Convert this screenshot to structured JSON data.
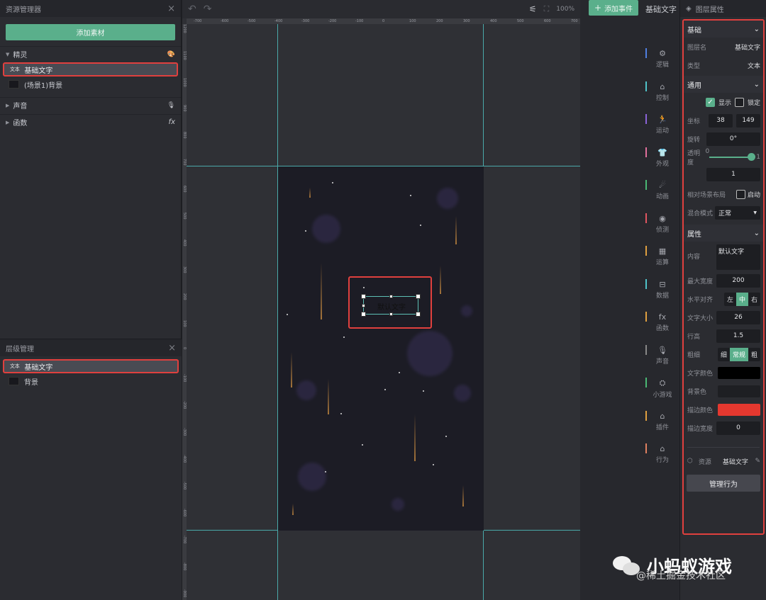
{
  "left_panel": {
    "title": "资源管理器",
    "close": "×",
    "add_button": "添加素材",
    "groups": [
      {
        "label": "精灵",
        "icon": "palette-icon",
        "glyph": "🎨"
      },
      {
        "label": "声音",
        "icon": "microphone-icon",
        "glyph": "🎙"
      },
      {
        "label": "函数",
        "icon": "function-icon",
        "glyph": "fx"
      }
    ],
    "sprites": [
      {
        "icon_text": "文本",
        "label": "基础文字",
        "selected": true
      },
      {
        "label": "(场景1)背景",
        "selected": false
      }
    ]
  },
  "layers_panel": {
    "title": "层级管理",
    "close": "×",
    "items": [
      {
        "icon_text": "文本",
        "label": "基础文字",
        "selected": true
      },
      {
        "label": "背景",
        "selected": false
      }
    ]
  },
  "toolbar": {
    "undo": "↶",
    "redo": "↷",
    "zoom": "100%"
  },
  "ruler": {
    "h_ticks": [
      "-700",
      "-600",
      "-500",
      "-400",
      "-300",
      "-200",
      "-100",
      "0",
      "100",
      "200",
      "300",
      "400",
      "500",
      "600",
      "700"
    ],
    "v_ticks": [
      "1200",
      "1100",
      "1000",
      "900",
      "800",
      "700",
      "600",
      "500",
      "400",
      "300",
      "200",
      "100",
      "0",
      "-100",
      "-200",
      "-300",
      "-400",
      "-500",
      "-600",
      "-700",
      "-800",
      "-900"
    ]
  },
  "canvas": {
    "default_text": "默认文字"
  },
  "event_strip": {
    "add_event": "添加事件",
    "current": "基础文字",
    "nav": [
      {
        "label": "逻辑",
        "icon": "logic-icon",
        "glyph": "⚙",
        "color": "#4f7fe0"
      },
      {
        "label": "控制",
        "icon": "control-icon",
        "glyph": "⌂",
        "color": "#4fc3c9"
      },
      {
        "label": "运动",
        "icon": "motion-icon",
        "glyph": "🏃",
        "color": "#8a63d8"
      },
      {
        "label": "外观",
        "icon": "appearance-icon",
        "glyph": "👕",
        "color": "#e06f9c"
      },
      {
        "label": "动画",
        "icon": "animation-icon",
        "glyph": "☄",
        "color": "#4ab874"
      },
      {
        "label": "侦测",
        "icon": "detect-icon",
        "glyph": "◉",
        "color": "#e05560"
      },
      {
        "label": "运算",
        "icon": "calc-icon",
        "glyph": "▦",
        "color": "#e0a040"
      },
      {
        "label": "数据",
        "icon": "data-icon",
        "glyph": "⊟",
        "color": "#4fc3c9"
      },
      {
        "label": "函数",
        "icon": "function-icon",
        "glyph": "fx",
        "color": "#e0a040"
      },
      {
        "label": "声音",
        "icon": "sound-icon",
        "glyph": "🎙",
        "color": "#888888"
      },
      {
        "label": "小游戏",
        "icon": "minigame-icon",
        "glyph": "⛭",
        "color": "#4ab874"
      },
      {
        "label": "插件",
        "icon": "plugin-icon",
        "glyph": "⌂",
        "color": "#e0a040"
      },
      {
        "label": "行为",
        "icon": "behavior-icon",
        "glyph": "⌂",
        "color": "#e08060"
      }
    ]
  },
  "right_panel": {
    "title": "图层属性",
    "basic": {
      "title": "基础",
      "layer_name_label": "图层名",
      "layer_name": "基础文字",
      "type_label": "类型",
      "type": "文本"
    },
    "common": {
      "title": "通用",
      "show": "显示",
      "lock": "锁定",
      "pos_label": "坐标",
      "x": "38",
      "y": "149",
      "rotate_label": "旋转",
      "rotate": "0°",
      "opacity_label": "透明度",
      "opacity_min": "0",
      "opacity_max": "1",
      "opacity": "1",
      "relative_label": "相对场景布局",
      "relative_toggle": "启动",
      "blend_label": "混合模式",
      "blend": "正常"
    },
    "attrs": {
      "title": "属性",
      "content_label": "内容",
      "content": "默认文字",
      "max_width_label": "最大宽度",
      "max_width": "200",
      "align_label": "水平对齐",
      "align_options": [
        "左",
        "中",
        "右"
      ],
      "font_size_label": "文字大小",
      "font_size": "26",
      "line_height_label": "行高",
      "line_height": "1.5",
      "weight_label": "粗细",
      "weight_options": [
        "细",
        "常规",
        "粗"
      ],
      "text_color_label": "文字颜色",
      "text_color": "#000000",
      "bg_color_label": "背景色",
      "bg_color": "#1e1f23",
      "stroke_color_label": "描边颜色",
      "stroke_color": "#e5382f",
      "stroke_width_label": "描边宽度",
      "stroke_width": "0"
    },
    "asset_label": "资源",
    "asset_value": "基础文字",
    "manage_button": "管理行为"
  },
  "watermark": {
    "title": "小蚂蚁游戏",
    "sub": "@稀土掘金技术社区"
  }
}
